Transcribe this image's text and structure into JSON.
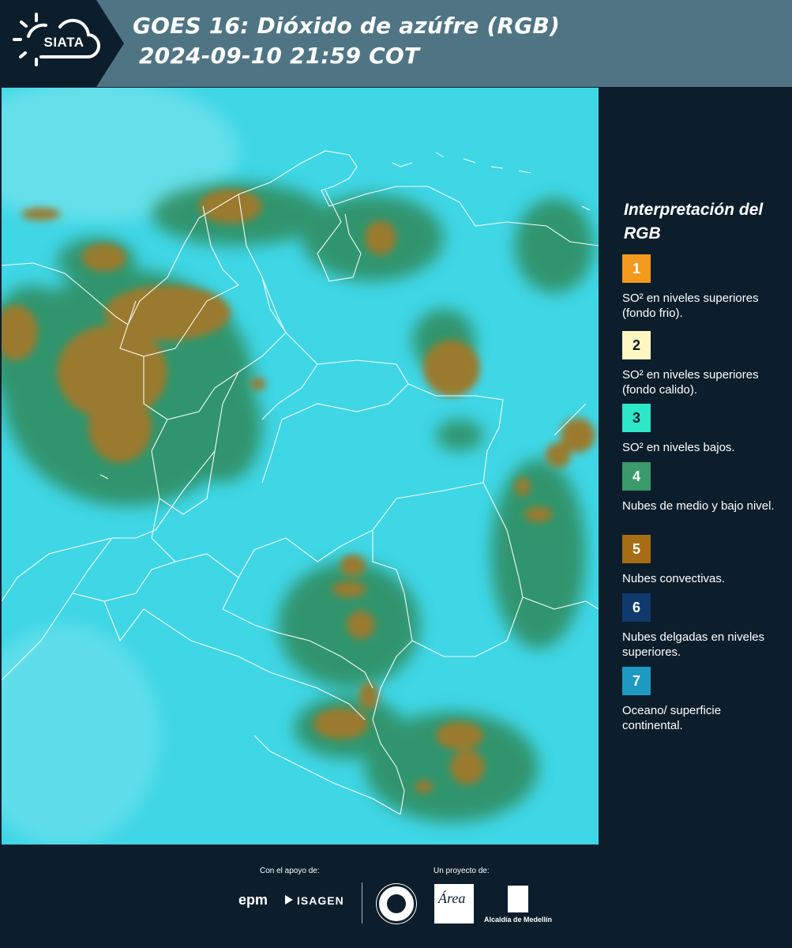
{
  "header": {
    "logo": "SIATA",
    "title_line1": "GOES 16: Dióxido de azúfre (RGB)",
    "title_line2": "2024-09-10 21:59 COT"
  },
  "map": {
    "background_color": "#3fd6e6",
    "cloud_colors": {
      "mid_low": "#2f8a5a",
      "convective": "#9a7a2e",
      "border": "#ffffff"
    }
  },
  "legend": {
    "title": "Interpretación del RGB",
    "items": [
      {
        "number": "1",
        "label": "SO² en niveles superiores (fondo frio).",
        "color": "#f39a1e",
        "text_color": "#ffffff"
      },
      {
        "number": "2",
        "label": "SO² en niveles superiores (fondo calido).",
        "color": "#fff7c2",
        "text_color": "#0c1e2c"
      },
      {
        "number": "3",
        "label": "SO² en niveles bajos.",
        "color": "#2ee6c8",
        "text_color": "#0c1e2c"
      },
      {
        "number": "4",
        "label": "Nubes de medio y bajo nivel.",
        "color": "#3a9a6a",
        "text_color": "#ffffff"
      },
      {
        "number": "5",
        "label": "Nubes convectivas.",
        "color": "#a66d14",
        "text_color": "#ffffff"
      },
      {
        "number": "6",
        "label": "Nubes delgadas en niveles superiores.",
        "color": "#103a6e",
        "text_color": "#ffffff"
      },
      {
        "number": "7",
        "label": "Oceano/ superficie continental.",
        "color": "#1e9ac2",
        "text_color": "#ffffff"
      }
    ]
  },
  "footer": {
    "support_label": "Con el apoyo de:",
    "project_label": "Un proyecto de:",
    "sponsor1": "epm",
    "sponsor2": "ISAGEN",
    "area_logo": "Área",
    "alcaldia": "Alcaldía de Medellín"
  }
}
